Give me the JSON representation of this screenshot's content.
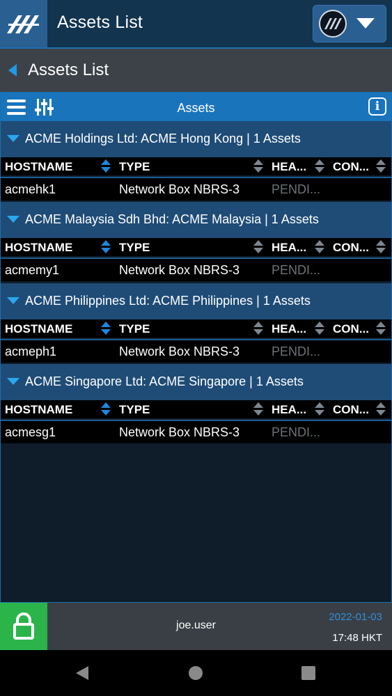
{
  "app": {
    "title": "Assets List"
  },
  "breadcrumb": {
    "title": "Assets List"
  },
  "panel": {
    "title": "Assets"
  },
  "columns": {
    "hostname": "HOSTNAME",
    "type": "TYPE",
    "health": "HEA...",
    "connection": "CON..."
  },
  "groups": [
    {
      "label": "ACME Holdings Ltd: ACME Hong Kong | 1 Assets",
      "rows": [
        {
          "hostname": "acmehk1",
          "type": "Network Box NBRS-3",
          "health": "PENDI..."
        }
      ]
    },
    {
      "label": "ACME Malaysia Sdh Bhd: ACME Malaysia | 1 Assets",
      "rows": [
        {
          "hostname": "acmemy1",
          "type": "Network Box NBRS-3",
          "health": "PENDI..."
        }
      ]
    },
    {
      "label": "ACME Philippines Ltd: ACME Philippines | 1 Assets",
      "rows": [
        {
          "hostname": "acmeph1",
          "type": "Network Box NBRS-3",
          "health": "PENDI..."
        }
      ]
    },
    {
      "label": "ACME Singapore Ltd: ACME Singapore | 1 Assets",
      "rows": [
        {
          "hostname": "acmesg1",
          "type": "Network Box NBRS-3",
          "health": "PENDI..."
        }
      ]
    }
  ],
  "footer": {
    "user": "joe.user",
    "date": "2022-01-03",
    "time": "17:48 HKT"
  },
  "colors": {
    "accent": "#1a74bb",
    "group": "#1f4c77",
    "lock": "#2bb44a",
    "date": "#2f8fd9"
  },
  "icons": {
    "app_logo": "app-logo-icon",
    "brand": "brand-badge-icon",
    "back": "back-arrow-icon",
    "menu": "menu-icon",
    "filter": "filter-sliders-icon",
    "info": "info-icon",
    "lock": "lock-icon"
  }
}
